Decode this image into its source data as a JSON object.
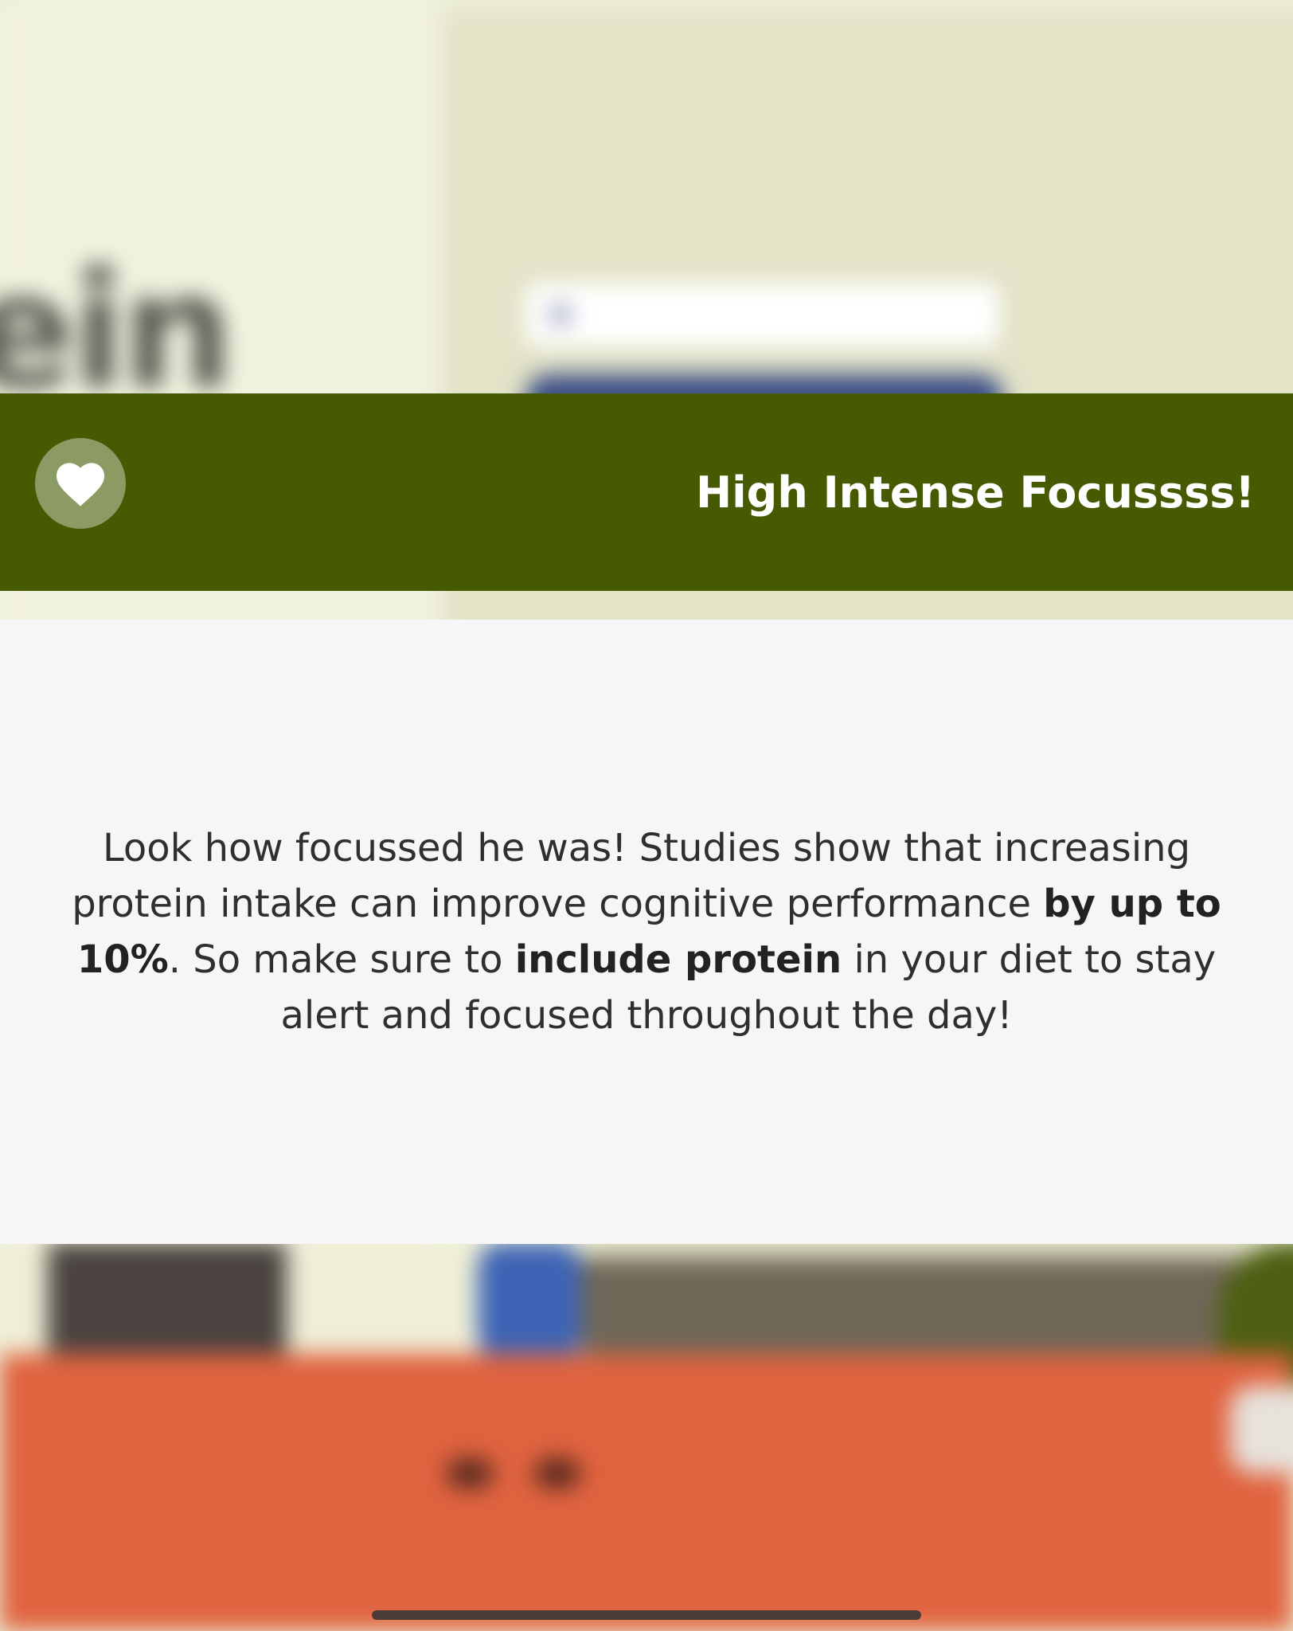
{
  "background": {
    "big_word": "ein"
  },
  "banner": {
    "title": "High Intense Focussss!",
    "icon": "heart-icon",
    "color": "#465b01"
  },
  "info_panel": {
    "text_parts": [
      {
        "text": "Look how focussed he was! Studies show that increasing protein intake can improve cognitive performance ",
        "bold": false
      },
      {
        "text": "by up to 10%",
        "bold": true
      },
      {
        "text": ". So make sure to ",
        "bold": false
      },
      {
        "text": "include protein",
        "bold": true
      },
      {
        "text": " in your diet to stay alert and focused throughout the day!",
        "bold": false
      }
    ]
  }
}
